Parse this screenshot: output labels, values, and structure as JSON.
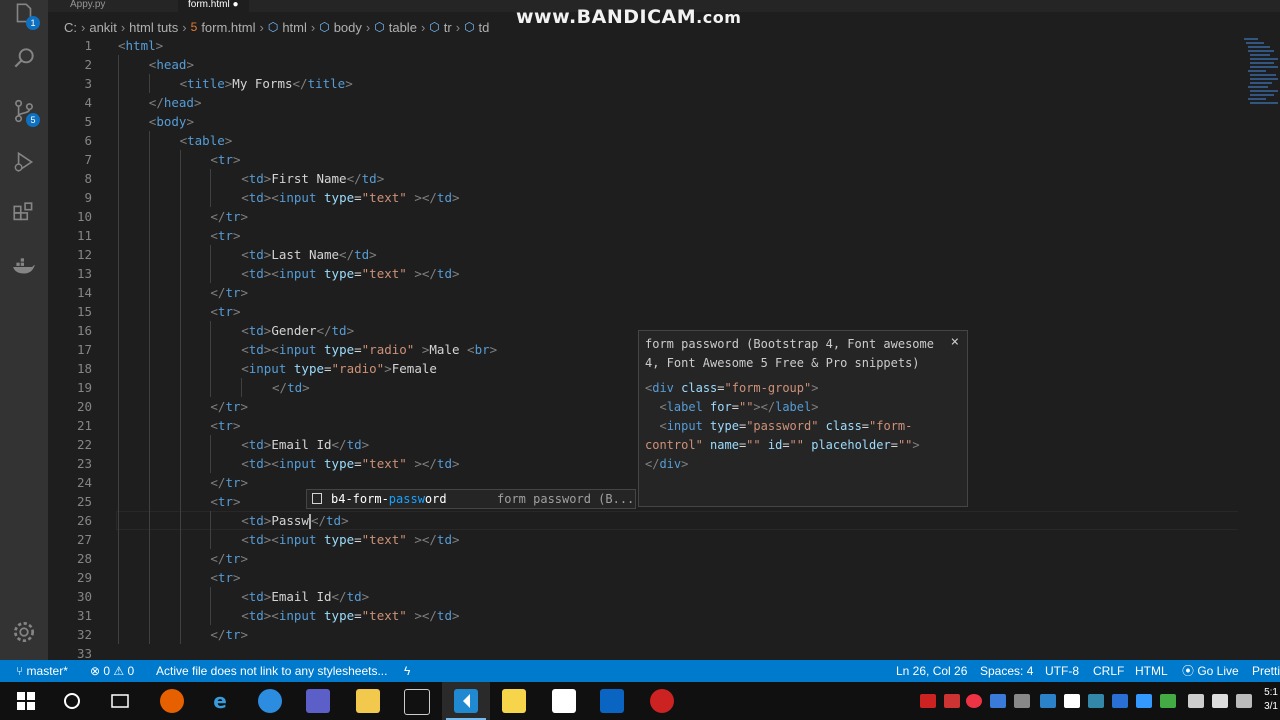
{
  "tabs": [
    {
      "label": "Appy.py"
    },
    {
      "label": "form.html ●"
    }
  ],
  "breadcrumbs": {
    "items": [
      "C:",
      "ankit",
      "html tuts",
      "form.html",
      "html",
      "body",
      "table",
      "tr",
      "td"
    ]
  },
  "watermark": {
    "main": "www.BANDICAM",
    "suffix": ".com"
  },
  "activity_bar": {
    "explorer_badge": "1",
    "scm_badge": "5"
  },
  "editor": {
    "lines": [
      {
        "n": "1",
        "indent": 0,
        "tokens": [
          [
            "b",
            "<"
          ],
          [
            "t",
            "html"
          ],
          [
            "b",
            ">"
          ]
        ]
      },
      {
        "n": "2",
        "indent": 1,
        "tokens": [
          [
            "b",
            "<"
          ],
          [
            "t",
            "head"
          ],
          [
            "b",
            ">"
          ]
        ]
      },
      {
        "n": "3",
        "indent": 2,
        "tokens": [
          [
            "b",
            "<"
          ],
          [
            "t",
            "title"
          ],
          [
            "b",
            ">"
          ],
          [
            "x",
            "My Forms"
          ],
          [
            "b",
            "</"
          ],
          [
            "t",
            "title"
          ],
          [
            "b",
            ">"
          ]
        ]
      },
      {
        "n": "4",
        "indent": 1,
        "tokens": [
          [
            "b",
            "</"
          ],
          [
            "t",
            "head"
          ],
          [
            "b",
            ">"
          ]
        ]
      },
      {
        "n": "5",
        "indent": 1,
        "tokens": [
          [
            "b",
            "<"
          ],
          [
            "t",
            "body"
          ],
          [
            "b",
            ">"
          ]
        ]
      },
      {
        "n": "6",
        "indent": 2,
        "tokens": [
          [
            "b",
            "<"
          ],
          [
            "t",
            "table"
          ],
          [
            "b",
            ">"
          ]
        ]
      },
      {
        "n": "7",
        "indent": 3,
        "tokens": [
          [
            "b",
            "<"
          ],
          [
            "t",
            "tr"
          ],
          [
            "b",
            ">"
          ]
        ]
      },
      {
        "n": "8",
        "indent": 4,
        "tokens": [
          [
            "b",
            "<"
          ],
          [
            "t",
            "td"
          ],
          [
            "b",
            ">"
          ],
          [
            "x",
            "First Name"
          ],
          [
            "b",
            "</"
          ],
          [
            "t",
            "td"
          ],
          [
            "b",
            ">"
          ]
        ]
      },
      {
        "n": "9",
        "indent": 4,
        "tokens": [
          [
            "b",
            "<"
          ],
          [
            "t",
            "td"
          ],
          [
            "b",
            "><"
          ],
          [
            "t",
            "input"
          ],
          [
            "x",
            " "
          ],
          [
            "a",
            "type"
          ],
          [
            "x",
            "="
          ],
          [
            "s",
            "\"text\""
          ],
          [
            "x",
            " "
          ],
          [
            "b",
            "></"
          ],
          [
            "t",
            "td"
          ],
          [
            "b",
            ">"
          ]
        ]
      },
      {
        "n": "10",
        "indent": 3,
        "tokens": [
          [
            "b",
            "</"
          ],
          [
            "t",
            "tr"
          ],
          [
            "b",
            ">"
          ]
        ]
      },
      {
        "n": "11",
        "indent": 3,
        "tokens": [
          [
            "b",
            "<"
          ],
          [
            "t",
            "tr"
          ],
          [
            "b",
            ">"
          ]
        ]
      },
      {
        "n": "12",
        "indent": 4,
        "tokens": [
          [
            "b",
            "<"
          ],
          [
            "t",
            "td"
          ],
          [
            "b",
            ">"
          ],
          [
            "x",
            "Last Name"
          ],
          [
            "b",
            "</"
          ],
          [
            "t",
            "td"
          ],
          [
            "b",
            ">"
          ]
        ]
      },
      {
        "n": "13",
        "indent": 4,
        "tokens": [
          [
            "b",
            "<"
          ],
          [
            "t",
            "td"
          ],
          [
            "b",
            "><"
          ],
          [
            "t",
            "input"
          ],
          [
            "x",
            " "
          ],
          [
            "a",
            "type"
          ],
          [
            "x",
            "="
          ],
          [
            "s",
            "\"text\""
          ],
          [
            "x",
            " "
          ],
          [
            "b",
            "></"
          ],
          [
            "t",
            "td"
          ],
          [
            "b",
            ">"
          ]
        ]
      },
      {
        "n": "14",
        "indent": 3,
        "tokens": [
          [
            "b",
            "</"
          ],
          [
            "t",
            "tr"
          ],
          [
            "b",
            ">"
          ]
        ]
      },
      {
        "n": "15",
        "indent": 3,
        "tokens": [
          [
            "b",
            "<"
          ],
          [
            "t",
            "tr"
          ],
          [
            "b",
            ">"
          ]
        ]
      },
      {
        "n": "16",
        "indent": 4,
        "tokens": [
          [
            "b",
            "<"
          ],
          [
            "t",
            "td"
          ],
          [
            "b",
            ">"
          ],
          [
            "x",
            "Gender"
          ],
          [
            "b",
            "</"
          ],
          [
            "t",
            "td"
          ],
          [
            "b",
            ">"
          ]
        ]
      },
      {
        "n": "17",
        "indent": 4,
        "tokens": [
          [
            "b",
            "<"
          ],
          [
            "t",
            "td"
          ],
          [
            "b",
            "><"
          ],
          [
            "t",
            "input"
          ],
          [
            "x",
            " "
          ],
          [
            "a",
            "type"
          ],
          [
            "x",
            "="
          ],
          [
            "s",
            "\"radio\""
          ],
          [
            "x",
            " "
          ],
          [
            "b",
            ">"
          ],
          [
            "x",
            "Male "
          ],
          [
            "b",
            "<"
          ],
          [
            "t",
            "br"
          ],
          [
            "b",
            ">"
          ]
        ]
      },
      {
        "n": "18",
        "indent": 4,
        "tokens": [
          [
            "b",
            "<"
          ],
          [
            "t",
            "input"
          ],
          [
            "x",
            " "
          ],
          [
            "a",
            "type"
          ],
          [
            "x",
            "="
          ],
          [
            "s",
            "\"radio\""
          ],
          [
            "b",
            ">"
          ],
          [
            "x",
            "Female"
          ]
        ]
      },
      {
        "n": "19",
        "indent": 5,
        "tokens": [
          [
            "b",
            "</"
          ],
          [
            "t",
            "td"
          ],
          [
            "b",
            ">"
          ]
        ]
      },
      {
        "n": "20",
        "indent": 3,
        "tokens": [
          [
            "b",
            "</"
          ],
          [
            "t",
            "tr"
          ],
          [
            "b",
            ">"
          ]
        ]
      },
      {
        "n": "21",
        "indent": 3,
        "tokens": [
          [
            "b",
            "<"
          ],
          [
            "t",
            "tr"
          ],
          [
            "b",
            ">"
          ]
        ]
      },
      {
        "n": "22",
        "indent": 4,
        "tokens": [
          [
            "b",
            "<"
          ],
          [
            "t",
            "td"
          ],
          [
            "b",
            ">"
          ],
          [
            "x",
            "Email Id"
          ],
          [
            "b",
            "</"
          ],
          [
            "t",
            "td"
          ],
          [
            "b",
            ">"
          ]
        ]
      },
      {
        "n": "23",
        "indent": 4,
        "tokens": [
          [
            "b",
            "<"
          ],
          [
            "t",
            "td"
          ],
          [
            "b",
            "><"
          ],
          [
            "t",
            "input"
          ],
          [
            "x",
            " "
          ],
          [
            "a",
            "type"
          ],
          [
            "x",
            "="
          ],
          [
            "s",
            "\"text\""
          ],
          [
            "x",
            " "
          ],
          [
            "b",
            "></"
          ],
          [
            "t",
            "td"
          ],
          [
            "b",
            ">"
          ]
        ]
      },
      {
        "n": "24",
        "indent": 3,
        "tokens": [
          [
            "b",
            "</"
          ],
          [
            "t",
            "tr"
          ],
          [
            "b",
            ">"
          ]
        ]
      },
      {
        "n": "25",
        "indent": 3,
        "tokens": [
          [
            "b",
            "<"
          ],
          [
            "t",
            "tr"
          ],
          [
            "b",
            ">"
          ]
        ]
      },
      {
        "n": "26",
        "indent": 4,
        "tokens": [
          [
            "b",
            "<"
          ],
          [
            "t",
            "td"
          ],
          [
            "b",
            ">"
          ],
          [
            "x",
            "Passw"
          ],
          [
            "cursor",
            ""
          ],
          [
            "b",
            "</"
          ],
          [
            "t",
            "td"
          ],
          [
            "b",
            ">"
          ]
        ],
        "current": true
      },
      {
        "n": "27",
        "indent": 4,
        "tokens": [
          [
            "b",
            "<"
          ],
          [
            "t",
            "td"
          ],
          [
            "b",
            "><"
          ],
          [
            "t",
            "input"
          ],
          [
            "x",
            " "
          ],
          [
            "a",
            "type"
          ],
          [
            "x",
            "="
          ],
          [
            "s",
            "\"text\""
          ],
          [
            "x",
            " "
          ],
          [
            "b",
            "></"
          ],
          [
            "t",
            "td"
          ],
          [
            "b",
            ">"
          ]
        ]
      },
      {
        "n": "28",
        "indent": 3,
        "tokens": [
          [
            "b",
            "</"
          ],
          [
            "t",
            "tr"
          ],
          [
            "b",
            ">"
          ]
        ]
      },
      {
        "n": "29",
        "indent": 3,
        "tokens": [
          [
            "b",
            "<"
          ],
          [
            "t",
            "tr"
          ],
          [
            "b",
            ">"
          ]
        ]
      },
      {
        "n": "30",
        "indent": 4,
        "tokens": [
          [
            "b",
            "<"
          ],
          [
            "t",
            "td"
          ],
          [
            "b",
            ">"
          ],
          [
            "x",
            "Email Id"
          ],
          [
            "b",
            "</"
          ],
          [
            "t",
            "td"
          ],
          [
            "b",
            ">"
          ]
        ]
      },
      {
        "n": "31",
        "indent": 4,
        "tokens": [
          [
            "b",
            "<"
          ],
          [
            "t",
            "td"
          ],
          [
            "b",
            "><"
          ],
          [
            "t",
            "input"
          ],
          [
            "x",
            " "
          ],
          [
            "a",
            "type"
          ],
          [
            "x",
            "="
          ],
          [
            "s",
            "\"text\""
          ],
          [
            "x",
            " "
          ],
          [
            "b",
            "></"
          ],
          [
            "t",
            "td"
          ],
          [
            "b",
            ">"
          ]
        ]
      },
      {
        "n": "32",
        "indent": 3,
        "tokens": [
          [
            "b",
            "</"
          ],
          [
            "t",
            "tr"
          ],
          [
            "b",
            ">"
          ]
        ]
      },
      {
        "n": "33",
        "indent": 0,
        "tokens": []
      }
    ]
  },
  "suggest": {
    "label_pre": "b4-form-",
    "label_match": "passw",
    "label_post": "ord",
    "detail": "form password (B..."
  },
  "docs": {
    "title": "form password (Bootstrap 4, Font awesome 4, Font Awesome 5 Free & Pro snippets)",
    "close": "×",
    "code": [
      [
        [
          "b",
          "<"
        ],
        [
          "t",
          "div"
        ],
        [
          "x",
          " "
        ],
        [
          "a",
          "class"
        ],
        [
          "x",
          "="
        ],
        [
          "s",
          "\"form-group\""
        ],
        [
          "b",
          ">"
        ]
      ],
      [
        [
          "x",
          "  "
        ],
        [
          "b",
          "<"
        ],
        [
          "t",
          "label"
        ],
        [
          "x",
          " "
        ],
        [
          "a",
          "for"
        ],
        [
          "x",
          "="
        ],
        [
          "s",
          "\"\""
        ],
        [
          "b",
          "></"
        ],
        [
          "t",
          "label"
        ],
        [
          "b",
          ">"
        ]
      ],
      [
        [
          "x",
          "  "
        ],
        [
          "b",
          "<"
        ],
        [
          "t",
          "input"
        ],
        [
          "x",
          " "
        ],
        [
          "a",
          "type"
        ],
        [
          "x",
          "="
        ],
        [
          "s",
          "\"password\""
        ],
        [
          "x",
          " "
        ],
        [
          "a",
          "class"
        ],
        [
          "x",
          "="
        ],
        [
          "s",
          "\"form-"
        ]
      ],
      [
        [
          "s",
          "control\""
        ],
        [
          "x",
          " "
        ],
        [
          "a",
          "name"
        ],
        [
          "x",
          "="
        ],
        [
          "s",
          "\"\""
        ],
        [
          "x",
          " "
        ],
        [
          "a",
          "id"
        ],
        [
          "x",
          "="
        ],
        [
          "s",
          "\"\""
        ],
        [
          "x",
          " "
        ],
        [
          "a",
          "placeholder"
        ],
        [
          "x",
          "="
        ],
        [
          "s",
          "\"\""
        ],
        [
          "b",
          ">"
        ]
      ],
      [
        [
          "b",
          "</"
        ],
        [
          "t",
          "div"
        ],
        [
          "b",
          ">"
        ]
      ]
    ]
  },
  "status": {
    "branch": "master*",
    "problems": "⊗ 0 ⚠ 0",
    "message": "Active file does not link to any stylesheets...",
    "position": "Ln 26, Col 26",
    "spaces": "Spaces: 4",
    "encoding": "UTF-8",
    "eol": "CRLF",
    "language": "HTML",
    "golive": "Go Live",
    "prettier": "Pretti"
  },
  "clock": {
    "time": "5:1",
    "date": "3/1"
  }
}
